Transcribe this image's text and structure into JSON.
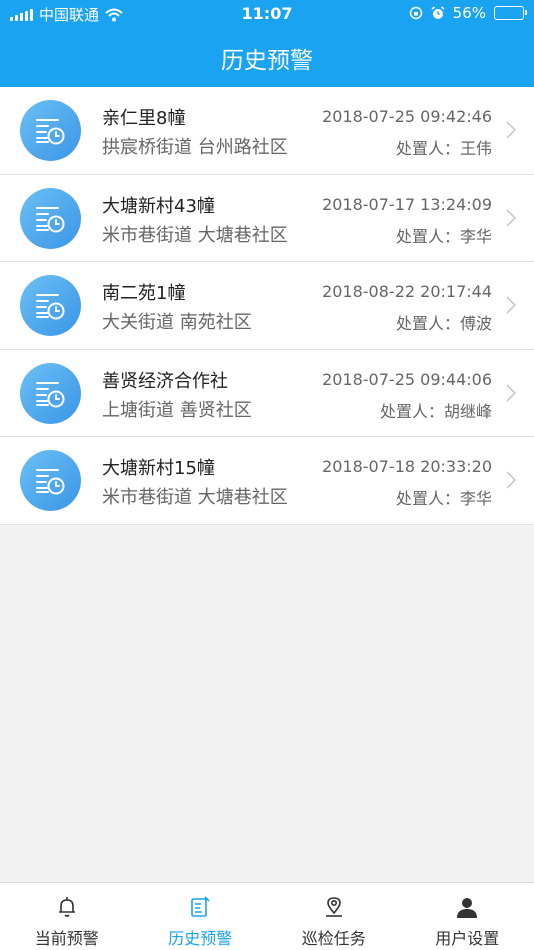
{
  "status_bar": {
    "carrier": "中国联通",
    "time": "11:07",
    "battery": "56%",
    "battery_level": 0.56
  },
  "header": {
    "title": "历史预警"
  },
  "records": [
    {
      "name": "亲仁里8幢",
      "address": "拱宸桥街道 台州路社区",
      "datetime": "2018-07-25 09:42:46",
      "handler": "处置人：王伟"
    },
    {
      "name": "大塘新村43幢",
      "address": "米市巷街道 大塘巷社区",
      "datetime": "2018-07-17 13:24:09",
      "handler": "处置人：李华"
    },
    {
      "name": "南二苑1幢",
      "address": "大关街道 南苑社区",
      "datetime": "2018-08-22 20:17:44",
      "handler": "处置人：傅波"
    },
    {
      "name": "善贤经济合作社",
      "address": "上塘街道 善贤社区",
      "datetime": "2018-07-25 09:44:06",
      "handler": "处置人：胡继峰"
    },
    {
      "name": "大塘新村15幢",
      "address": "米市巷街道 大塘巷社区",
      "datetime": "2018-07-18 20:33:20",
      "handler": "处置人：李华"
    }
  ],
  "tabbar": {
    "tabs": [
      {
        "label": "当前预警",
        "icon": "bell-icon"
      },
      {
        "label": "历史预警",
        "icon": "history-icon"
      },
      {
        "label": "巡检任务",
        "icon": "location-pin-icon"
      },
      {
        "label": "用户设置",
        "icon": "user-icon"
      }
    ],
    "active_index": 1
  },
  "colors": {
    "header": "#1aa3f0",
    "active_tab": "#1aa3f0",
    "background": "#f2f2f2"
  }
}
